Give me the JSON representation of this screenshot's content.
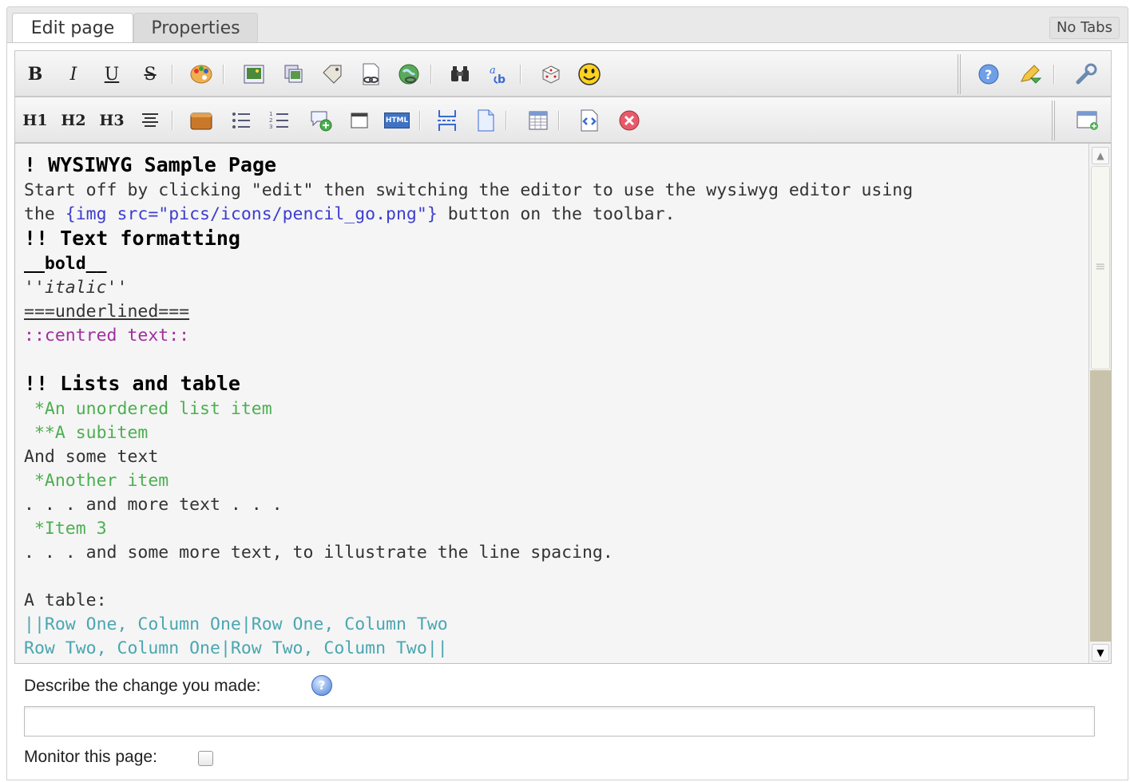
{
  "tabs": {
    "edit_page": "Edit page",
    "properties": "Properties",
    "no_tabs": "No Tabs"
  },
  "toolbar1": {
    "bold": "B",
    "italic": "I",
    "underline": "U",
    "strike": "S"
  },
  "toolbar2": {
    "h1": "H1",
    "h2": "H2",
    "h3": "H3",
    "html_badge": "HTML"
  },
  "editor": {
    "lines": [
      "! WYSIWYG Sample Page",
      "Start off by clicking \"edit\" then switching the editor to use the wysiwyg editor using",
      "the ",
      "{img src=\"pics/icons/pencil_go.png\"}",
      " button on the toolbar.",
      "!! Text formatting",
      "__bold__",
      "''italic''",
      "===underlined===",
      "::centred text::",
      "!! Lists and table",
      " *An unordered list item",
      " **A subitem",
      "And some text",
      " *Another item",
      ". . . and more text . . .",
      " *Item 3",
      ". . . and some more text, to illustrate the line spacing.",
      "A table:",
      "||Row One, Column One|Row One, Column Two",
      "Row Two, Column One|Row Two, Column Two||"
    ]
  },
  "form": {
    "describe_label": "Describe the change you made:",
    "describe_value": "",
    "monitor_label": "Monitor this page:",
    "monitor_checked": false
  },
  "icons": {
    "help": "help-icon"
  }
}
